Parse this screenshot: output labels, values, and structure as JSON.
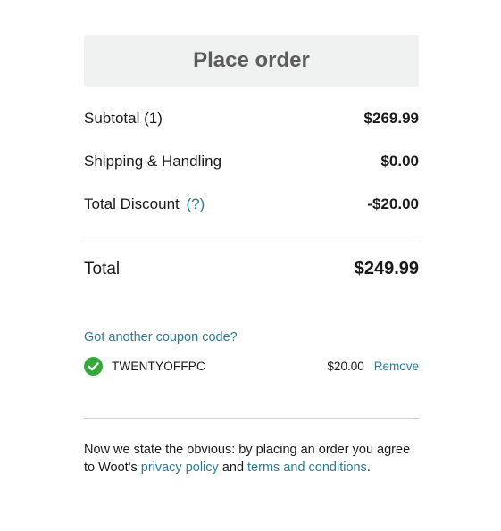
{
  "place_order": {
    "label": "Place order"
  },
  "summary": {
    "subtotal_label": "Subtotal (1)",
    "subtotal_value": "$269.99",
    "shipping_label": "Shipping & Handling",
    "shipping_value": "$0.00",
    "discount_label": "Total Discount",
    "discount_help": "(?)",
    "discount_value": "-$20.00",
    "total_label": "Total",
    "total_value": "$249.99"
  },
  "coupon": {
    "link_label": "Got another coupon code?",
    "icon": "check-circle-icon",
    "code": "TWENTYOFFPC",
    "amount": "$20.00",
    "remove_label": "Remove"
  },
  "legal": {
    "text_before": "Now we state the obvious: by placing an order you agree to Woot's ",
    "privacy_label": "privacy policy",
    "text_middle": " and ",
    "terms_label": "terms and conditions",
    "text_after": "."
  },
  "colors": {
    "link": "#2e7a94",
    "button_bg": "#eff0f0",
    "button_text": "#5c5c5c",
    "check_green": "#35a83b"
  }
}
